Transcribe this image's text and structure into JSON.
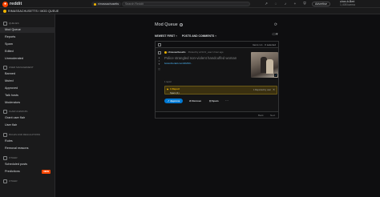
{
  "header": {
    "logo_text": "reddit",
    "community_chip": "r/massachusetts",
    "search_placeholder": "Search Reddit",
    "advertise_label": "Advertise",
    "username": "u/xxx-b-Bert",
    "karma": "1,408 karma"
  },
  "breadcrumb": "R/MASSACHUSETTS / MOD QUEUE",
  "sidebar": {
    "sections": [
      {
        "title": "QUEUES",
        "items": [
          "Mod Queue",
          "Reports",
          "Spam",
          "Edited",
          "Unmoderated"
        ]
      },
      {
        "title": "USER MANAGEMENT",
        "items": [
          "Banned",
          "Muted",
          "Approved",
          "Talk hosts",
          "Moderators"
        ]
      },
      {
        "title": "FLAIR & EMOJIS",
        "items": [
          "Grant user flair",
          "User flair"
        ]
      },
      {
        "title": "RULES AND REGULATIONS",
        "items": [
          "Rules",
          "Removal reasons"
        ]
      },
      {
        "title": "OTHER",
        "items": [
          "Scheduled posts",
          "Predictions"
        ]
      },
      {
        "title": "OTHER"
      }
    ],
    "new_badge": "NEW"
  },
  "main": {
    "title": "Mod Queue",
    "filters": {
      "sort": "NEWEST FIRST",
      "type": "POSTS AND COMMENTS"
    },
    "item_count": "Items 1-1 · 0 selected",
    "post": {
      "subreddit": "r/massachusetts",
      "meta": "· Posted by u/zzzzz_user 1 hour ago",
      "title": "Police strangled non-violent handcuffed woman",
      "link": "bostonherald.com/2023/0...",
      "vote_score": "1",
      "reports_label": "1 report",
      "report": {
        "count": "1 Report",
        "reason": "Spam (1)",
        "right_text": "1 Reported by user"
      },
      "actions": {
        "approve": "Approve",
        "remove": "Remove",
        "spam": "Spam"
      }
    },
    "pager": {
      "prev": "Back",
      "next": "Next"
    }
  }
}
